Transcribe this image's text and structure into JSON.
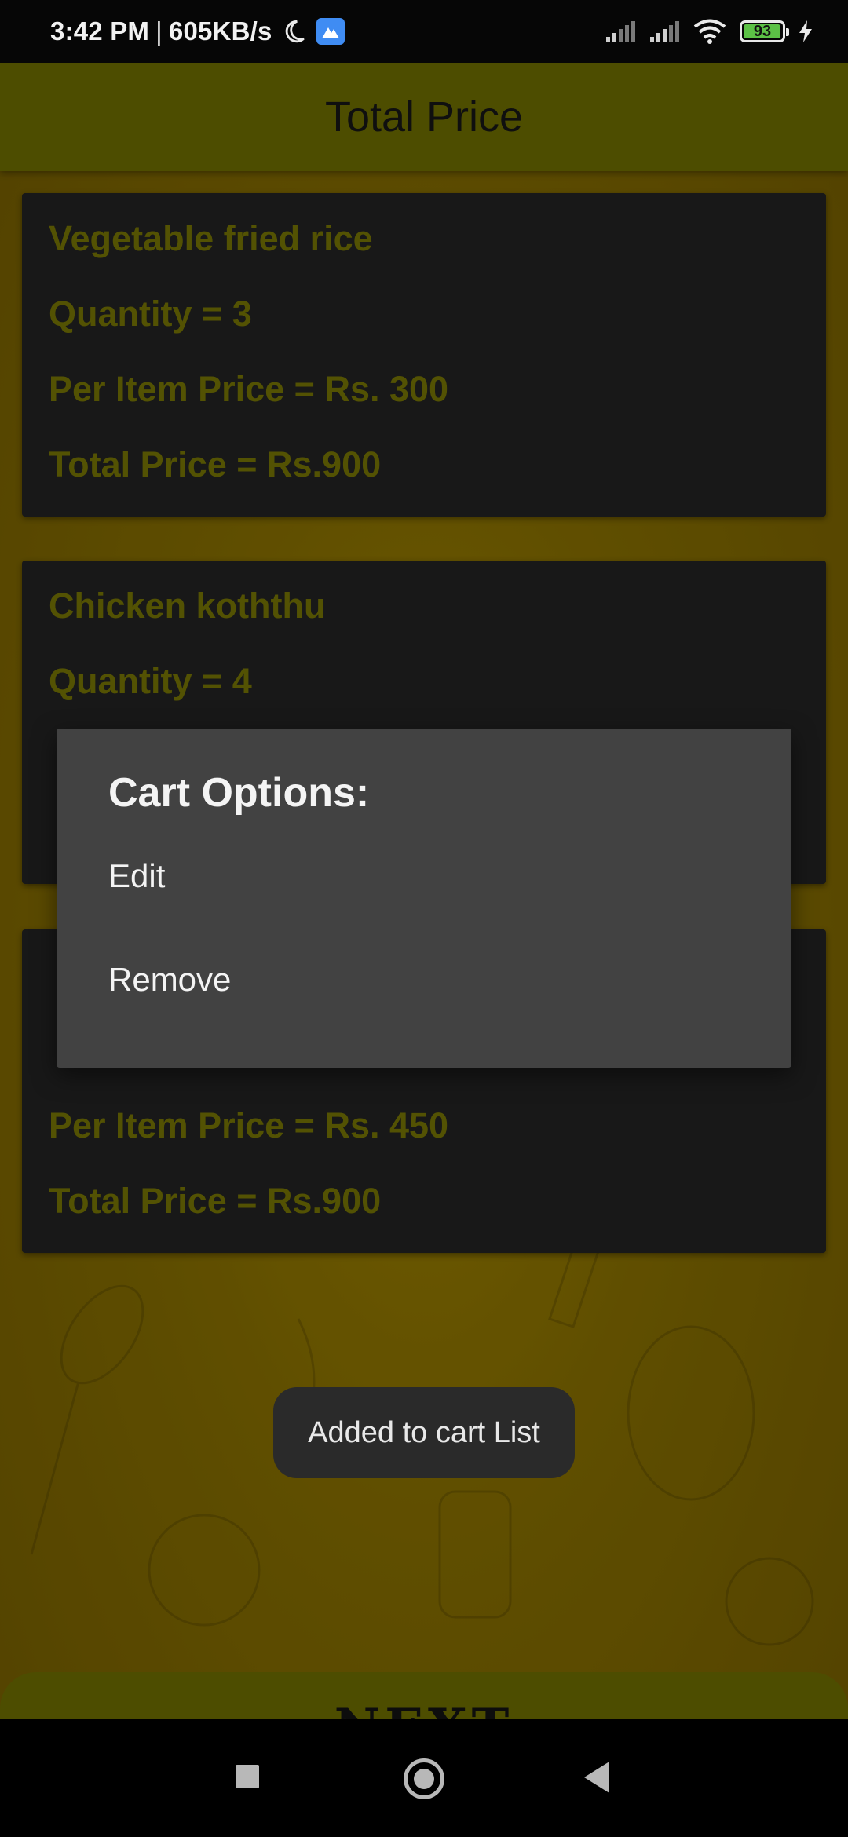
{
  "status_bar": {
    "time": "3:42 PM",
    "separator": "|",
    "network_speed": "605KB/s",
    "battery_level": "93",
    "icons": [
      "moon-icon",
      "app-badge-icon",
      "signal-1-icon",
      "signal-2-icon",
      "wifi-icon",
      "battery-icon",
      "charging-bolt-icon"
    ]
  },
  "app_bar": {
    "title": "Total Price"
  },
  "cart": {
    "items": [
      {
        "name": "Vegetable fried rice",
        "quantity": "Quantity = 3",
        "per_item_price": "Per Item Price = Rs. 300",
        "total_price": "Total Price = Rs.900"
      },
      {
        "name": "Chicken koththu",
        "quantity": "Quantity = 4"
      },
      {
        "per_item_price": "Per Item Price = Rs. 450",
        "total_price": "Total Price = Rs.900"
      }
    ]
  },
  "dialog": {
    "title": "Cart Options:",
    "options": [
      "Edit",
      "Remove"
    ]
  },
  "toast": {
    "message": "Added to cart List"
  },
  "footer": {
    "next_label": "NEXT"
  },
  "colors": {
    "app_bar": "#636300",
    "card_background": "#1f1f1f",
    "card_text": "#6b6a05",
    "dialog_background": "#424242",
    "background": "#7a6400"
  }
}
